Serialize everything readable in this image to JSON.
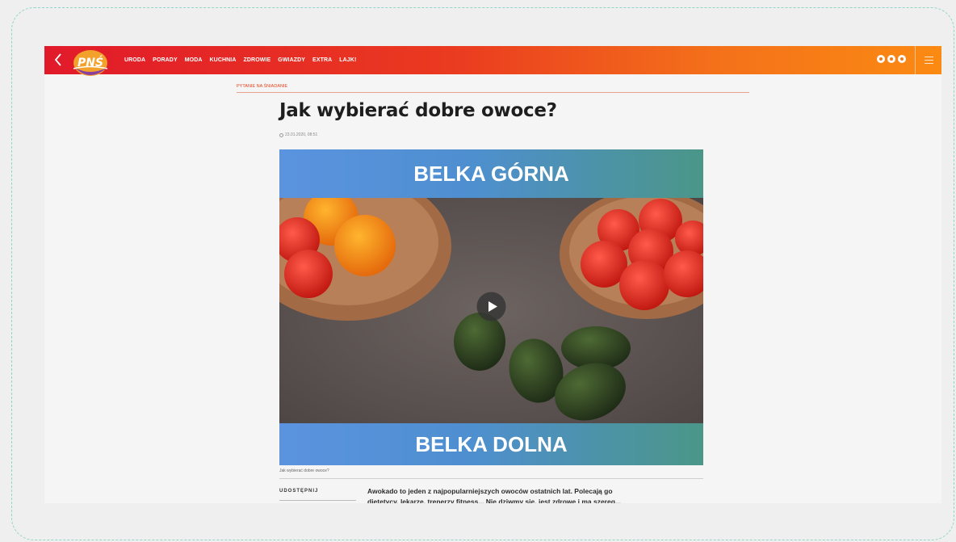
{
  "nav": {
    "brand": "PNŚ",
    "links": [
      "URODA",
      "PORADY",
      "MODA",
      "KUCHNIA",
      "ZDROWIE",
      "GWIAZDY",
      "EXTRA",
      "LAJK!"
    ]
  },
  "article": {
    "category": "PYTANIE NA ŚNIADANIE",
    "title": "Jak wybierać dobre owoce?",
    "date": "23.01.2020, 08:51",
    "banner_top": "BELKA GÓRNA",
    "banner_bottom": "BELKA DOLNA",
    "caption": "Jak wybierać dobre owoce?",
    "share_label": "UDOSTĘPNIJ",
    "lead_line1": "Awokado to jeden z najpopularniejszych owoców ostatnich lat. Polecają go",
    "lead_line2": "dietetycy, lekarze, trenerzy fitness... Nie dziwmy się, jest zdrowe i ma szereg..."
  },
  "colors": {
    "nav_start": "#e11a2a",
    "nav_end": "#fb8a12",
    "banner_start": "#5b93df",
    "banner_end": "#4b9688",
    "category": "#e8431e"
  }
}
